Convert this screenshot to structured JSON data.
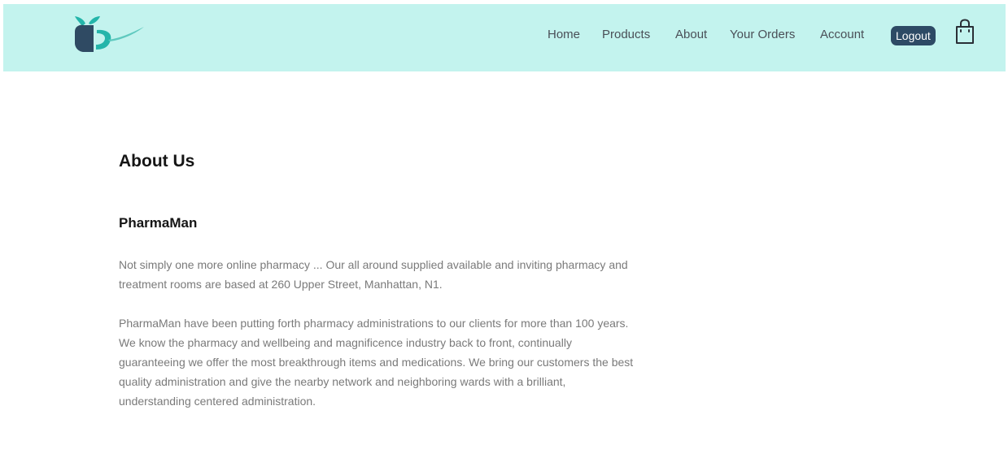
{
  "header": {
    "nav_links": [
      "Home",
      "Products",
      "About",
      "Your Orders",
      "Account"
    ],
    "logout_label": "Logout",
    "colors": {
      "nav_background": "#c3f3ee",
      "logout_button": "#2d4a65",
      "logo_dark": "#2f4a63",
      "logo_teal": "#24b5aa"
    },
    "icons": [
      "logo-icon",
      "shopping-bag-icon"
    ]
  },
  "main": {
    "title": "About Us",
    "section_title": "PharmaMan",
    "paragraphs": [
      "Not simply one more online pharmacy ... Our all around supplied available and inviting pharmacy and treatment rooms are based at 260 Upper Street, Manhattan, N1.",
      "PharmaMan have been putting forth pharmacy administrations to our clients for more than 100 years. We know the pharmacy and wellbeing and magnificence industry back to front, continually guaranteeing we offer the most breakthrough items and medications. We bring our customers the best quality administration and give the nearby network and neighboring wards with a brilliant, understanding centered administration."
    ]
  }
}
